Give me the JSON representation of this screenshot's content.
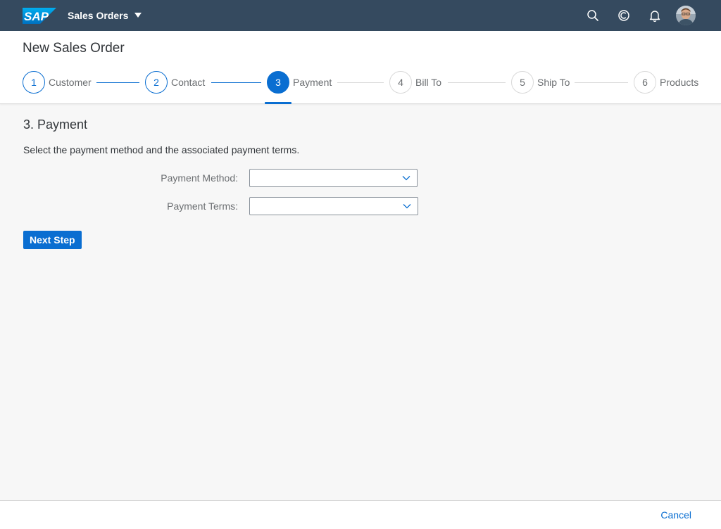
{
  "shell": {
    "logo_text": "SAP",
    "app_title": "Sales Orders",
    "icons": [
      "search-icon",
      "co-pilot-icon",
      "bell-icon",
      "user-avatar"
    ]
  },
  "header": {
    "title": "New Sales Order",
    "steps": [
      {
        "number": "1",
        "label": "Customer",
        "state": "done"
      },
      {
        "number": "2",
        "label": "Contact",
        "state": "done"
      },
      {
        "number": "3",
        "label": "Payment",
        "state": "current"
      },
      {
        "number": "4",
        "label": "Bill To",
        "state": "future"
      },
      {
        "number": "5",
        "label": "Ship To",
        "state": "future"
      },
      {
        "number": "6",
        "label": "Products",
        "state": "future"
      }
    ]
  },
  "content": {
    "section_title": "3. Payment",
    "description": "Select the payment method and the associated payment terms.",
    "fields": {
      "payment_method": {
        "label": "Payment Method:",
        "value": ""
      },
      "payment_terms": {
        "label": "Payment Terms:",
        "value": ""
      }
    },
    "next_button": "Next Step"
  },
  "footer": {
    "cancel": "Cancel"
  },
  "colors": {
    "shell": "#354a5f",
    "accent": "#0a6ed1",
    "background": "#f7f7f7"
  }
}
